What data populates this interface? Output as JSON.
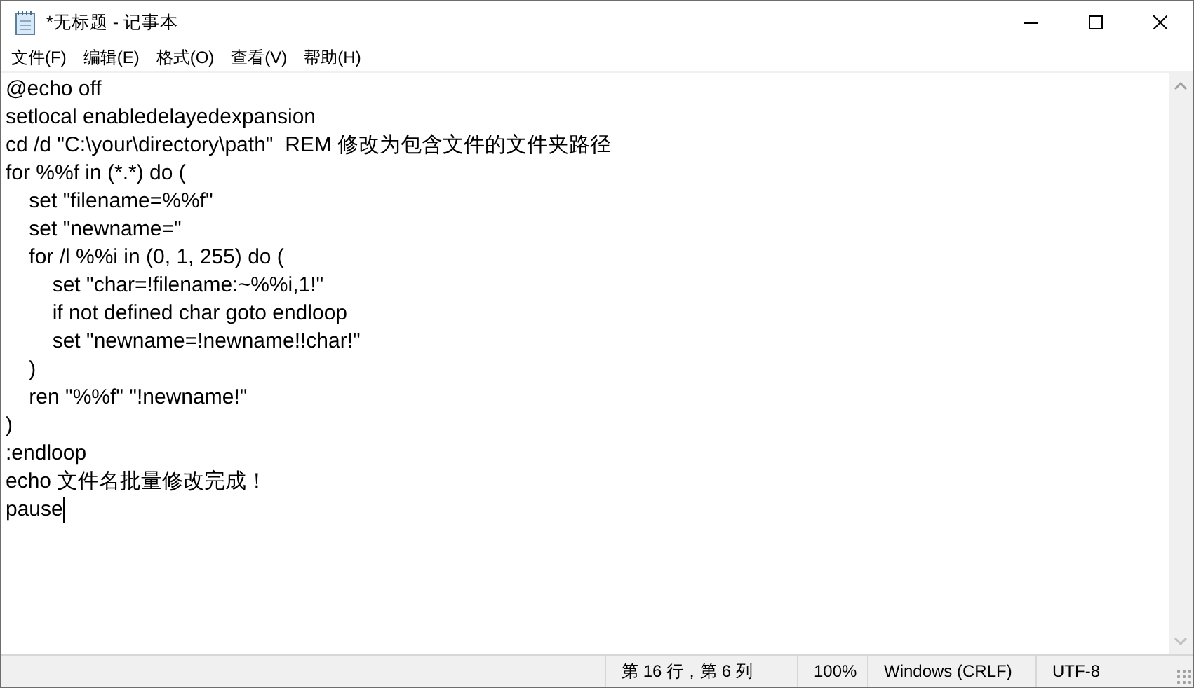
{
  "window": {
    "title": "*无标题 - 记事本"
  },
  "menu": [
    "文件(F)",
    "编辑(E)",
    "格式(O)",
    "查看(V)",
    "帮助(H)"
  ],
  "editor": {
    "lines": [
      "@echo off",
      "setlocal enabledelayedexpansion",
      "cd /d \"C:\\your\\directory\\path\"  REM 修改为包含文件的文件夹路径",
      "for %%f in (*.*) do (",
      "    set \"filename=%%f\"",
      "    set \"newname=\"",
      "    for /l %%i in (0, 1, 255) do (",
      "        set \"char=!filename:~%%i,1!\"",
      "        if not defined char goto endloop",
      "        set \"newname=!newname!!char!\"",
      "    )",
      "    ren \"%%f\" \"!newname!\"",
      ")",
      ":endloop",
      "echo 文件名批量修改完成！",
      "pause"
    ]
  },
  "status_bar": [
    "第 16 行，第 6 列",
    "100%",
    "Windows (CRLF)",
    "UTF-8"
  ]
}
